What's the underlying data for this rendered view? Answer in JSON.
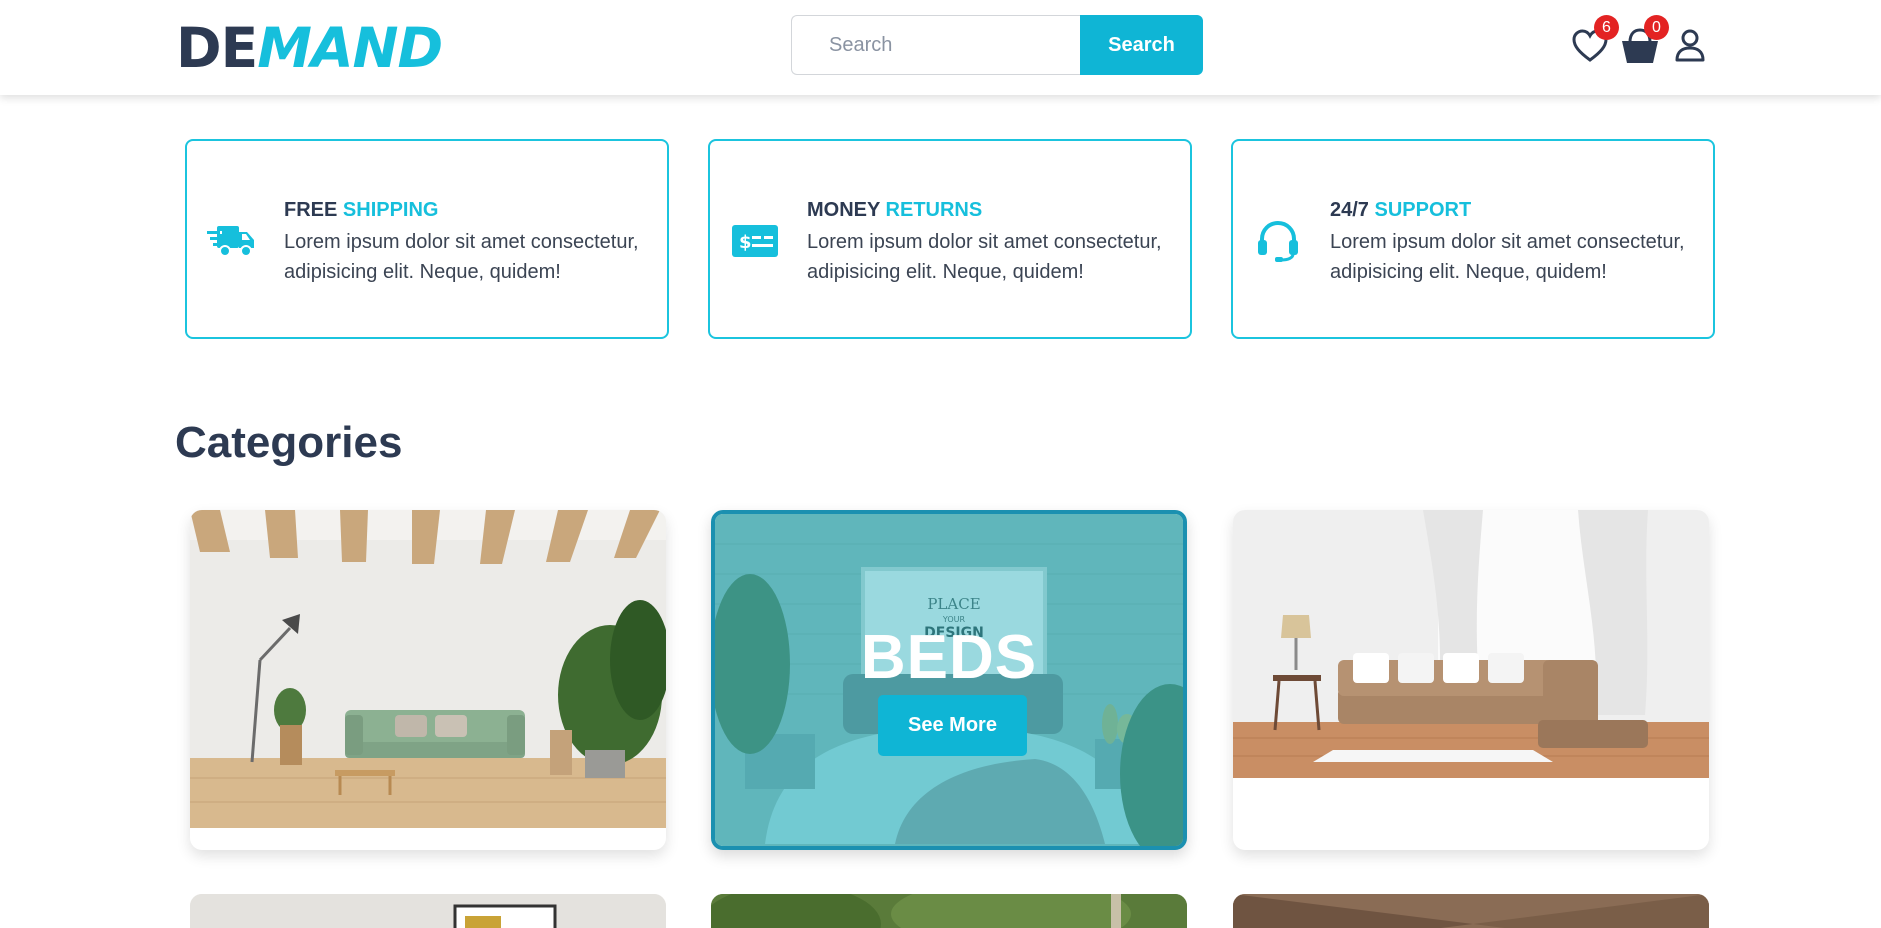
{
  "brand": {
    "logo_part1": "DE",
    "logo_part2": "MAND"
  },
  "search": {
    "placeholder": "Search",
    "button_label": "Search"
  },
  "header_icons": {
    "wishlist_count": "6",
    "cart_count": "0",
    "wishlist_icon": "heart-icon",
    "cart_icon": "basket-icon",
    "account_icon": "user-icon"
  },
  "features": [
    {
      "title_plain": "FREE",
      "title_highlight": "SHIPPING",
      "description": "Lorem ipsum dolor sit amet consectetur, adipisicing elit. Neque, quidem!",
      "icon": "truck-icon"
    },
    {
      "title_plain": "MONEY",
      "title_highlight": "RETURNS",
      "description": "Lorem ipsum dolor sit amet consectetur, adipisicing elit. Neque, quidem!",
      "icon": "money-icon"
    },
    {
      "title_plain": "24/7",
      "title_highlight": "SUPPORT",
      "description": "Lorem ipsum dolor sit amet consectetur, adipisicing elit. Neque, quidem!",
      "icon": "headset-icon"
    }
  ],
  "categories": {
    "title": "Categories",
    "active": {
      "name": "BEDS",
      "button_label": "See More"
    }
  },
  "colors": {
    "accent": "#0fb5d5",
    "dark": "#2d3a52",
    "badge": "#e32323"
  }
}
